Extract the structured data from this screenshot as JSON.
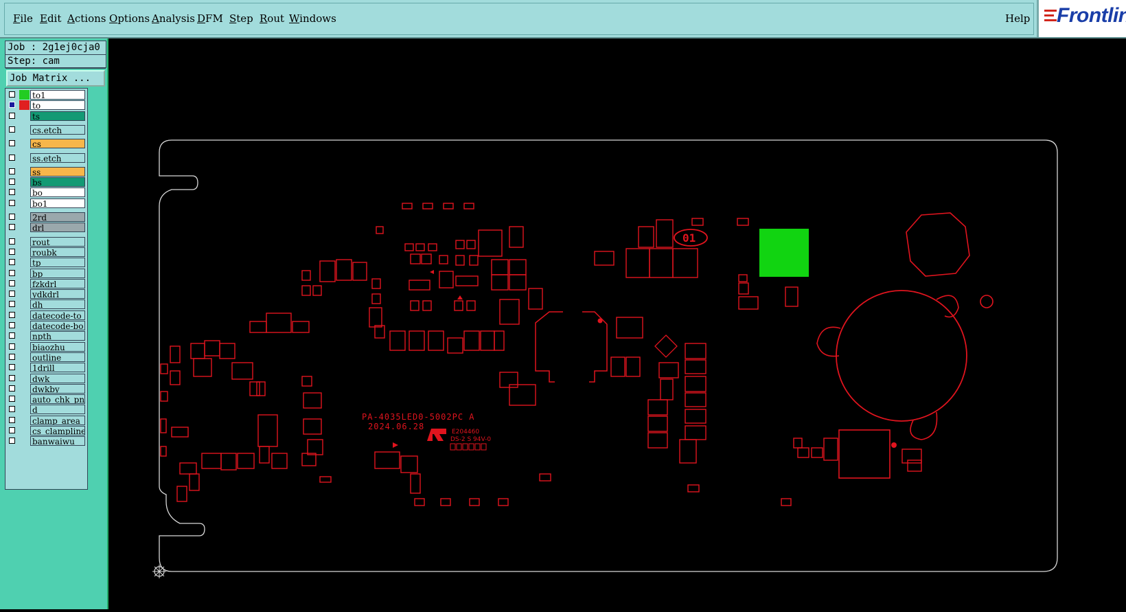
{
  "menu": {
    "items": [
      "File",
      "Edit",
      "Actions",
      "Options",
      "Analysis",
      "DFM",
      "Step",
      "Rout",
      "Windows"
    ],
    "help": "Help"
  },
  "brand": {
    "logo_text": "Frontline"
  },
  "job": {
    "job_line": "Job : 2g1ej0cja0",
    "step_line": "Step: cam",
    "matrix_button": "Job Matrix ..."
  },
  "layers": [
    {
      "name": "to1",
      "bg": "#ffffff",
      "swatch": "#22cc22",
      "active": false
    },
    {
      "name": "to",
      "bg": "#ffffff",
      "swatch": "#e02020",
      "active": true
    },
    {
      "name": "ts",
      "bg": "#139a74",
      "swatch": "",
      "active": false
    },
    {
      "name": "cs.etch",
      "bg": "#a2dcdc",
      "swatch": "",
      "active": false
    },
    {
      "name": "cs",
      "bg": "#f7b64a",
      "swatch": "",
      "active": false
    },
    {
      "name": "ss.etch",
      "bg": "#a2dcdc",
      "swatch": "",
      "active": false
    },
    {
      "name": "ss",
      "bg": "#f7b64a",
      "swatch": "",
      "active": false
    },
    {
      "name": "bs",
      "bg": "#139a74",
      "swatch": "",
      "active": false
    },
    {
      "name": "bo",
      "bg": "#ffffff",
      "swatch": "",
      "active": false
    },
    {
      "name": "bo1",
      "bg": "#ffffff",
      "swatch": "",
      "active": false
    },
    {
      "name": "2rd",
      "bg": "#9aa8ac",
      "swatch": "",
      "active": false
    },
    {
      "name": "drl",
      "bg": "#9aa8ac",
      "swatch": "",
      "active": false
    },
    {
      "name": "rout",
      "bg": "#a2dcdc",
      "swatch": "",
      "active": false
    },
    {
      "name": "roubk",
      "bg": "#a2dcdc",
      "swatch": "",
      "active": false
    },
    {
      "name": "tp",
      "bg": "#a2dcdc",
      "swatch": "",
      "active": false
    },
    {
      "name": "bp",
      "bg": "#a2dcdc",
      "swatch": "",
      "active": false
    },
    {
      "name": "fzkdrl",
      "bg": "#a2dcdc",
      "swatch": "",
      "active": false
    },
    {
      "name": "ydkdrl",
      "bg": "#a2dcdc",
      "swatch": "",
      "active": false
    },
    {
      "name": "dh",
      "bg": "#a2dcdc",
      "swatch": "",
      "active": false
    },
    {
      "name": "datecode-to",
      "bg": "#a2dcdc",
      "swatch": "",
      "active": false
    },
    {
      "name": "datecode-bo",
      "bg": "#a2dcdc",
      "swatch": "",
      "active": false
    },
    {
      "name": "npth",
      "bg": "#a2dcdc",
      "swatch": "",
      "active": false
    },
    {
      "name": "biaozhu",
      "bg": "#a2dcdc",
      "swatch": "",
      "active": false
    },
    {
      "name": "outline",
      "bg": "#a2dcdc",
      "swatch": "",
      "active": false
    },
    {
      "name": "1drill",
      "bg": "#a2dcdc",
      "swatch": "",
      "active": false
    },
    {
      "name": "dwk",
      "bg": "#a2dcdc",
      "swatch": "",
      "active": false
    },
    {
      "name": "dwkby",
      "bg": "#a2dcdc",
      "swatch": "",
      "active": false
    },
    {
      "name": "auto_chk_pn",
      "bg": "#a2dcdc",
      "swatch": "",
      "active": false
    },
    {
      "name": "d",
      "bg": "#a2dcdc",
      "swatch": "",
      "active": false
    },
    {
      "name": "clamp_area",
      "bg": "#a2dcdc",
      "swatch": "",
      "active": false
    },
    {
      "name": "cs_clampline",
      "bg": "#a2dcdc",
      "swatch": "",
      "active": false
    },
    {
      "name": "banwaiwu",
      "bg": "#a2dcdc",
      "swatch": "",
      "active": false
    }
  ],
  "board": {
    "silk_line1": "PA-4035LED0-5002PC A",
    "silk_line2": "2024.06.28",
    "ul_code": "E204460",
    "ul_rating": "DS-2 S 94V-0",
    "marker": "01",
    "colors": {
      "trace": "#e0141e",
      "highlight": "#11d411",
      "outline": "#d8d8d8"
    }
  }
}
